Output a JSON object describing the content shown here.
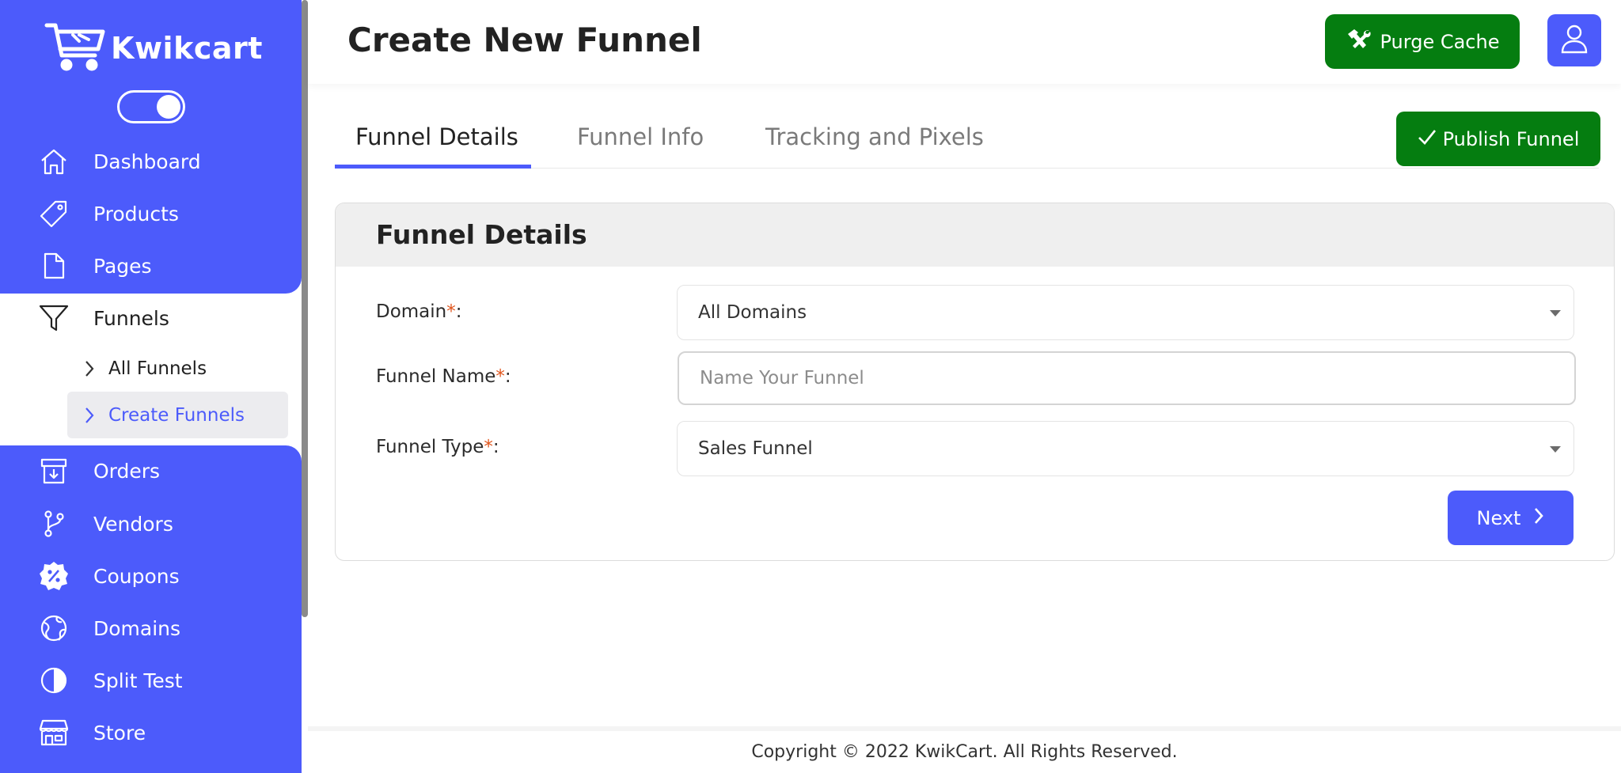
{
  "brand": {
    "name": "Kwikcart"
  },
  "sidebar": {
    "items": [
      {
        "label": "Dashboard",
        "icon": "home-icon"
      },
      {
        "label": "Products",
        "icon": "tag-icon"
      },
      {
        "label": "Pages",
        "icon": "file-icon"
      },
      {
        "label": "Funnels",
        "icon": "filter-icon",
        "active": true
      },
      {
        "label": "Orders",
        "icon": "archive-icon"
      },
      {
        "label": "Vendors",
        "icon": "branch-icon"
      },
      {
        "label": "Coupons",
        "icon": "percent-badge-icon"
      },
      {
        "label": "Domains",
        "icon": "globe-icon"
      },
      {
        "label": "Split Test",
        "icon": "half-circle-icon"
      },
      {
        "label": "Store",
        "icon": "store-icon"
      }
    ],
    "funnels_sub": [
      {
        "label": "All Funnels"
      },
      {
        "label": "Create Funnels",
        "selected": true
      }
    ]
  },
  "header": {
    "title": "Create New Funnel",
    "purge_label": "Purge Cache"
  },
  "tabs": [
    {
      "label": "Funnel Details",
      "active": true
    },
    {
      "label": "Funnel Info"
    },
    {
      "label": "Tracking and Pixels"
    }
  ],
  "publish_label": "Publish Funnel",
  "form": {
    "title": "Funnel Details",
    "domain_label": "Domain",
    "domain_value": "All Domains",
    "name_label": "Funnel Name",
    "name_placeholder": "Name Your Funnel",
    "type_label": "Funnel Type",
    "type_value": "Sales Funnel",
    "required_mark": "*",
    "next_label": "Next"
  },
  "footer": {
    "text": "Copyright © 2022 KwikCart. All Rights Reserved."
  },
  "colors": {
    "primary": "#4c5bfb",
    "success": "#057d10",
    "required": "#e0551c"
  }
}
